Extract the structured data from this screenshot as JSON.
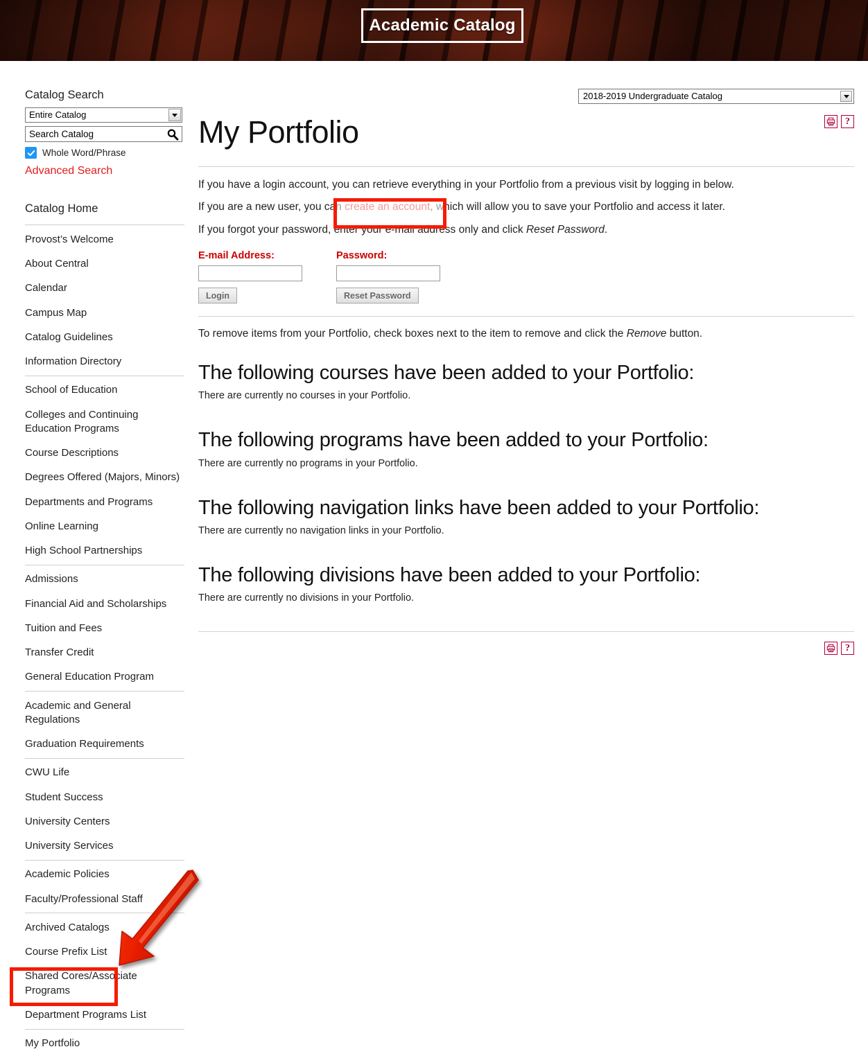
{
  "banner": {
    "title": "Academic Catalog"
  },
  "sidebar": {
    "search_heading": "Catalog Search",
    "scope_select": {
      "value": "Entire Catalog",
      "caret_icon": "chevron-down-icon"
    },
    "search_input": {
      "value": "",
      "placeholder": "Search Catalog",
      "icon": "search-icon"
    },
    "whole_word": {
      "label": "Whole Word/Phrase",
      "checked": true,
      "color": "#2196f3"
    },
    "advanced_search": "Advanced Search",
    "advanced_search_color": "#e21b1b",
    "nav_groups": [
      {
        "items": [
          "Catalog Home"
        ]
      },
      {
        "items": [
          "Provost’s Welcome",
          "About Central",
          "Calendar",
          "Campus Map",
          "Catalog Guidelines",
          "Information Directory"
        ]
      },
      {
        "items": [
          "School of Education",
          "Colleges and Continuing Education Programs",
          "Course Descriptions",
          "Degrees Offered (Majors, Minors)",
          "Departments and Programs",
          "Online Learning",
          "High School Partnerships"
        ]
      },
      {
        "items": [
          "Admissions",
          "Financial Aid and Scholarships",
          "Tuition and Fees",
          "Transfer Credit",
          "General Education Program"
        ]
      },
      {
        "items": [
          "Academic and General Regulations",
          "Graduation Requirements"
        ]
      },
      {
        "items": [
          "CWU Life",
          "Student Success",
          "University Centers",
          "University Services"
        ]
      },
      {
        "items": [
          "Academic Policies",
          "Faculty/Professional Staff"
        ]
      },
      {
        "items": [
          "Archived Catalogs",
          "Course Prefix List",
          "Shared Cores/Associate Programs",
          "Department Programs List"
        ]
      },
      {
        "items": [
          "My Portfolio"
        ]
      }
    ]
  },
  "main": {
    "catalog_select": {
      "value": "2018-2019 Undergraduate Catalog",
      "caret_icon": "chevron-down-icon"
    },
    "page_title": "My Portfolio",
    "icons": {
      "print": "printer-icon",
      "help": "question-mark-icon",
      "color": "#b0003a"
    },
    "intro": {
      "line1": "If you have a login account, you can retrieve everything in your Portfolio from a previous visit by logging in below.",
      "line2_before": "If you are a new user, you can ",
      "line2_link": "create an account",
      "line2_after": ", which will allow you to save your Portfolio and access it later.",
      "line3_before": "If you forgot your password, enter your e-mail address only and click ",
      "line3_em": "Reset Password",
      "line3_after": "."
    },
    "login_form": {
      "email_label": "E-mail Address:",
      "email_value": "",
      "password_label": "Password:",
      "password_value": "",
      "login_button": "Login",
      "reset_button": "Reset Password",
      "label_color": "#cc0000"
    },
    "remove_note_before": "To remove items from your Portfolio, check boxes next to the item to remove and click the ",
    "remove_note_em": "Remove",
    "remove_note_after": " button.",
    "sections": [
      {
        "heading": "The following courses have been added to your Portfolio:",
        "empty_note": "There are currently no courses in your Portfolio."
      },
      {
        "heading": "The following programs have been added to your Portfolio:",
        "empty_note": "There are currently no programs in your Portfolio."
      },
      {
        "heading": "The following navigation links have been added to your Portfolio:",
        "empty_note": "There are currently no navigation links in your Portfolio."
      },
      {
        "heading": "The following divisions have been added to your Portfolio:",
        "empty_note": "There are currently no divisions in your Portfolio."
      }
    ]
  },
  "annotations": {
    "highlight_color": "#f51b00",
    "boxes": [
      {
        "name": "create-account-highlight"
      },
      {
        "name": "my-portfolio-highlight"
      }
    ],
    "arrow": {
      "name": "pointer-arrow",
      "points_to": "My Portfolio"
    }
  }
}
